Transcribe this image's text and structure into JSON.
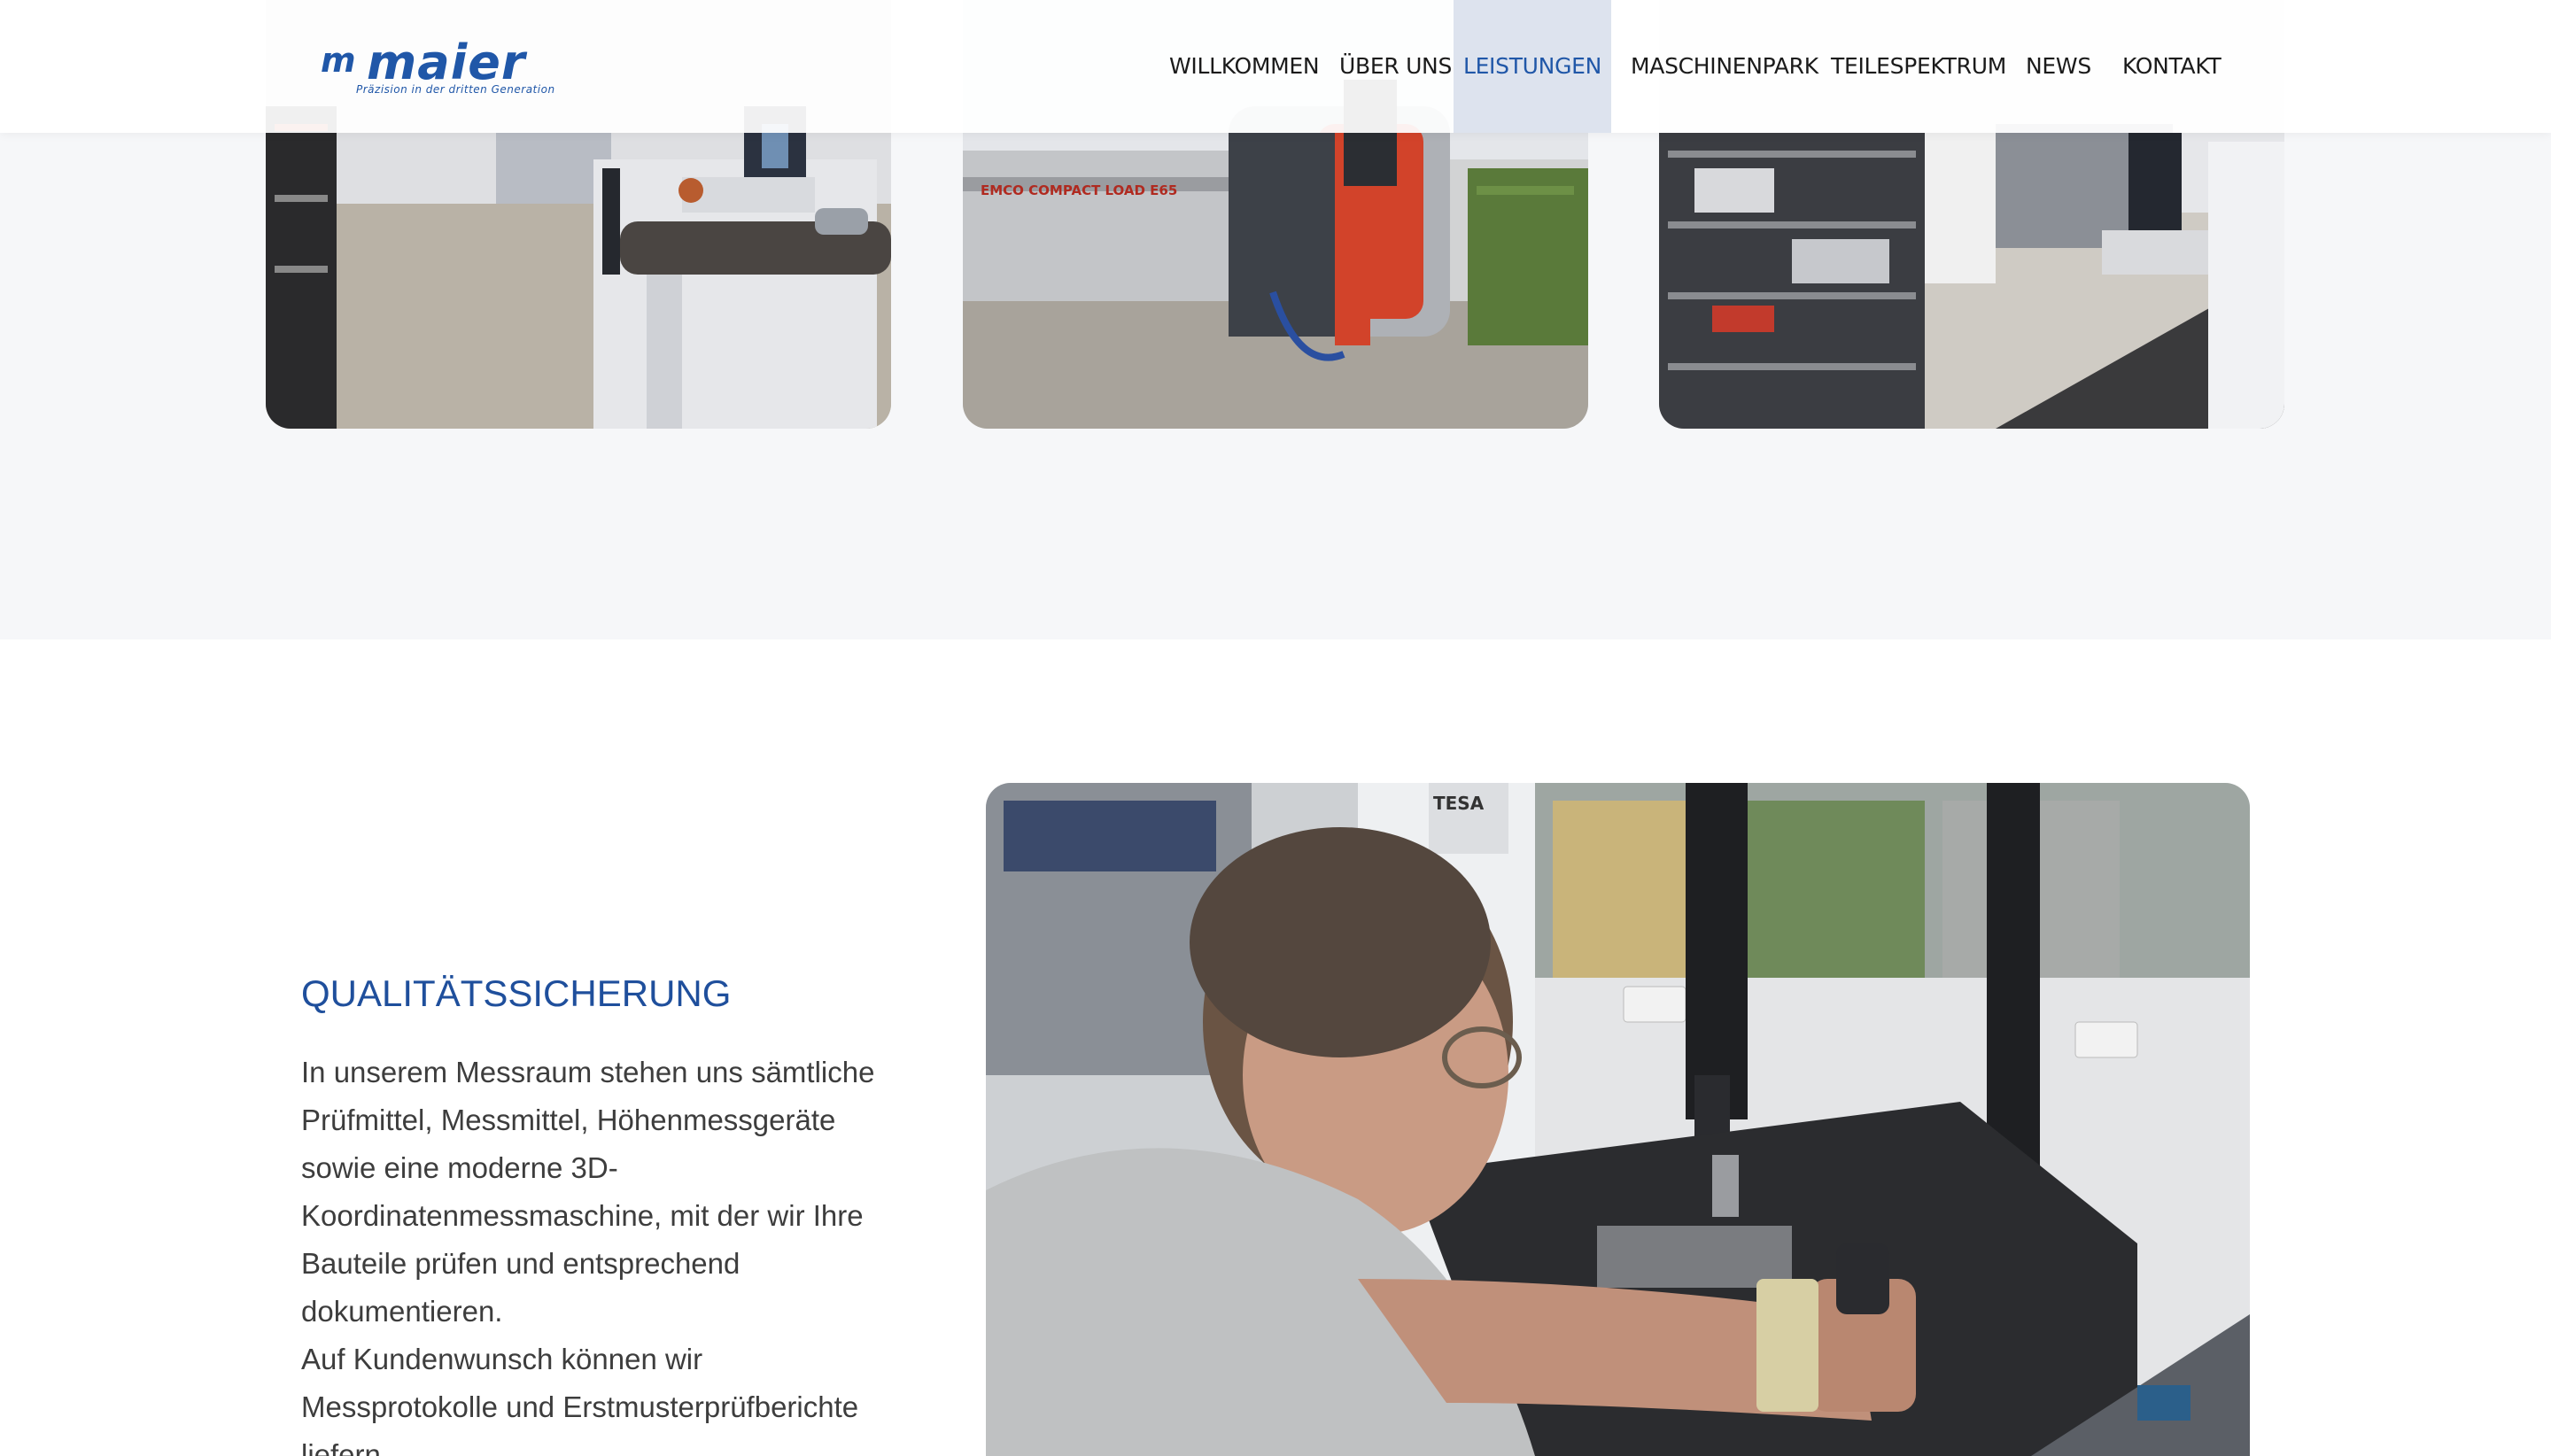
{
  "header": {
    "logo_mark": "m",
    "logo_text": "maier",
    "logo_tagline": "Präzision in der dritten Generation",
    "nav": [
      {
        "label": "WILLKOMMEN",
        "active": false
      },
      {
        "label": "ÜBER UNS",
        "active": false
      },
      {
        "label": "LEISTUNGEN",
        "active": true
      },
      {
        "label": "MASCHINENPARK",
        "active": false
      },
      {
        "label": "TEILESPEKTRUM",
        "active": false
      },
      {
        "label": "NEWS",
        "active": false
      },
      {
        "label": "KONTAKT",
        "active": false
      }
    ]
  },
  "gallery": {
    "photo_2_label": "EMCO COMPACT LOAD E65"
  },
  "quality": {
    "title": "QUALITÄTSSICHERUNG",
    "paragraph_1": "In unserem Messraum stehen uns sämtliche Prüfmittel, Messmittel, Höhenmessgeräte sowie eine moderne 3D-Koordinatenmessmaschine, mit der wir Ihre Bauteile prüfen und entsprechend dokumentieren.",
    "paragraph_2": "Auf Kundenwunsch können wir Messprotokolle und Erstmusterprüfberichte liefern.",
    "photo_label": "TESA"
  },
  "colors": {
    "brand_blue": "#2057a8",
    "nav_active_bg": "#dde3ee",
    "band_bg": "#f6f7f9"
  }
}
